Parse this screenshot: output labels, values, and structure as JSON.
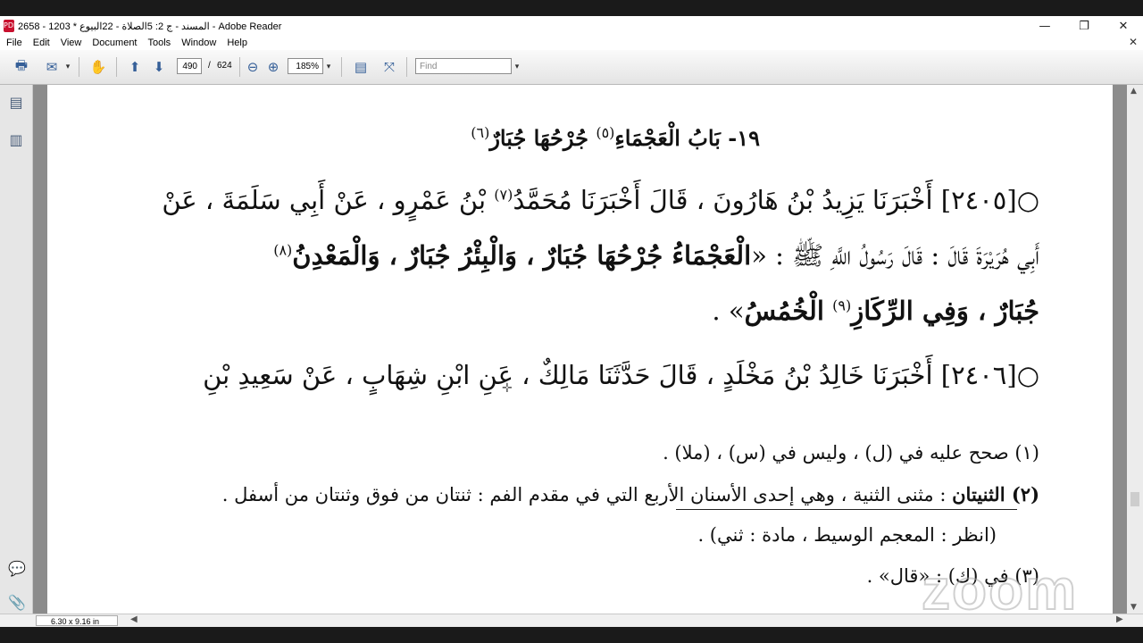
{
  "window": {
    "title": "2658 - 1203 * المسند - ج 2: 5الصلاة - 22البيوع - Adobe Reader",
    "app_icon": "PDF",
    "controls": {
      "minimize": "—",
      "restore": "❐",
      "close": "✕"
    }
  },
  "menu": {
    "items": [
      "File",
      "Edit",
      "View",
      "Document",
      "Tools",
      "Window",
      "Help"
    ],
    "close": "✕"
  },
  "toolbar": {
    "page_current": "490",
    "page_separator": "/",
    "page_total": "624",
    "zoom": "185%",
    "find_placeholder": "Find",
    "dropdown_arrow": "▾",
    "icons": {
      "print": "🖶",
      "mail": "✉",
      "hand": "✋",
      "prev": "⬆",
      "next": "⬇",
      "zoom_out": "⊖",
      "zoom_in": "⊕",
      "fit_page": "▤",
      "fit_width": "⤧"
    }
  },
  "left_panel": {
    "icons": {
      "pages": "▤",
      "bookmarks": "▥",
      "comments": "💬",
      "attachments": "📎"
    }
  },
  "document": {
    "heading_num": "١٩-",
    "heading_text": "بَابُ الْعَجْمَاءِ",
    "heading_ref1": "(٥)",
    "heading_text2": "جُرْحُهَا جُبَارٌ",
    "heading_ref2": "(٦)",
    "h2405_a": "○[٢٤٠٥] أَخْبَرَنَا يَزِيدُ بْنُ هَارُونَ ، قَالَ أَخْبَرَنَا مُحَمَّدُ",
    "h2405_ref7": "(٧)",
    "h2405_b": "بْنُ عَمْرٍو ، عَنْ أَبِي سَلَمَةَ ، عَنْ",
    "line2_a": "أَبِي هُرَيْرَةَ قَالَ : قَالَ رَسُولُ اللَّهِ ﷺ : «",
    "line2_bold": "الْعَجْمَاءُ جُرْحُهَا جُبَارٌ ، وَالْبِئْرُ جُبَارٌ ، وَالْمَعْدِنُ",
    "line2_ref8": "(٨)",
    "line3_bold1": "جُبَارٌ ، وَفِي الرِّكَازِ",
    "line3_ref9": "(٩)",
    "line3_bold2": "الْخُمُسُ",
    "line3_end": "» .",
    "h2406": "○[٢٤٠٦] أَخْبَرَنَا خَالِدُ بْنُ مَخْلَدٍ ، قَالَ حَدَّثَنَا مَالِكٌ ، عَنِ ابْنِ شِهَابٍ ، عَنْ سَعِيدِ بْنِ",
    "fn1": "(١) صحح عليه في (ل) ، وليس في (س) ، (ملا) .",
    "fn2_label": "(٢) الثنيتان",
    "fn2_text": ": مثنى الثنية ، وهي إحدى الأسنان الأربع التي في مقدم الفم : ثنتان من فوق وثنتان من أسفل .",
    "fn2_cont": "(انظر : المعجم الوسيط ، مادة : ثني) .",
    "fn3": "(٣) في (ك) : «قال» ."
  },
  "status": {
    "page_size": "6.30 x 9.16 in"
  },
  "watermark": "zoom"
}
